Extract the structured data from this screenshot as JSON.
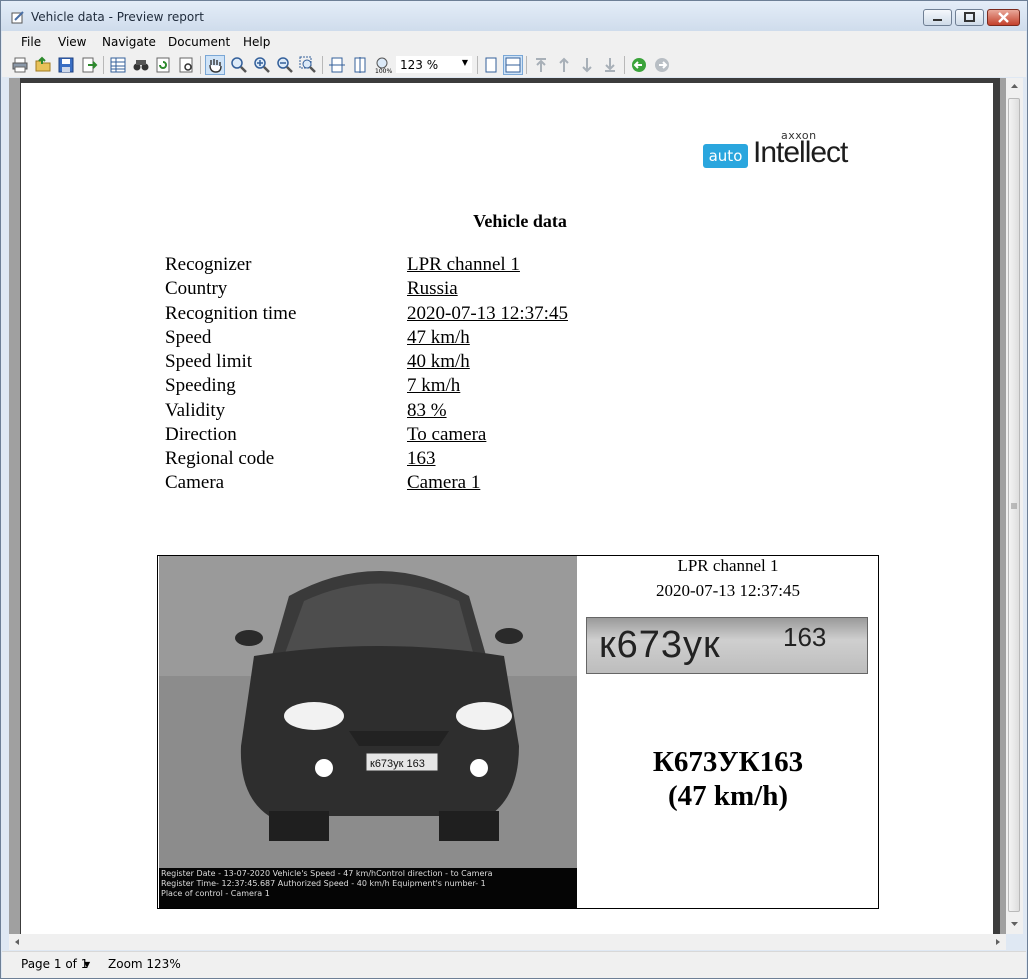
{
  "window": {
    "title": "Vehicle data - Preview report"
  },
  "menu": [
    "File",
    "View",
    "Navigate",
    "Document",
    "Help"
  ],
  "toolbar": {
    "zoom_value": "123 %",
    "icons": [
      "print-icon",
      "open-icon",
      "save-icon",
      "export-icon",
      "table-icon",
      "find-icon",
      "refresh-icon",
      "page-setup-icon",
      "hand-icon",
      "zoom-icon",
      "zoom-in-icon",
      "zoom-out-icon",
      "zoom-area-icon",
      "fit-width-icon",
      "fit-page-icon",
      "zoom-100-icon",
      "single-page-icon",
      "multi-page-icon",
      "first-page-icon",
      "prev-page-icon",
      "next-page-icon",
      "last-page-icon",
      "back-icon",
      "forward-icon"
    ]
  },
  "logo": {
    "axxon": "axxon",
    "auto": "auto",
    "intellect": "Intellect"
  },
  "report": {
    "title": "Vehicle data",
    "fields": [
      {
        "label": "Recognizer",
        "value": "LPR channel  1"
      },
      {
        "label": "Country",
        "value": "Russia"
      },
      {
        "label": "Recognition time",
        "value": "2020-07-13 12:37:45"
      },
      {
        "label": "Speed",
        "value": "47 km/h"
      },
      {
        "label": "Speed limit",
        "value": "40 km/h"
      },
      {
        "label": "Speeding",
        "value": "7 km/h"
      },
      {
        "label": "Validity",
        "value": "83 %"
      },
      {
        "label": "Direction",
        "value": "To camera"
      },
      {
        "label": "Regional code",
        "value": "163"
      },
      {
        "label": "Camera",
        "value": "Camera 1"
      }
    ],
    "photo": {
      "car_plate_text": "к673ук 163",
      "overlay_lines": [
        "Register Date - 13-07-2020     Vehicle's Speed - 47 km/hControl direction - to Camera",
        "Register Time- 12:37:45.687   Authorized Speed - 40 km/h    Equipment's number- 1",
        "Place of control - Camera 1"
      ]
    },
    "side": {
      "channel": "LPR channel  1",
      "time": "2020-07-13 12:37:45",
      "plate_crop_main": "к673ук",
      "plate_crop_region": "163",
      "plate": "К673УК163",
      "speed": "(47 km/h)"
    }
  },
  "status": {
    "page": "Page 1 of 1",
    "zoom": "Zoom 123%"
  }
}
